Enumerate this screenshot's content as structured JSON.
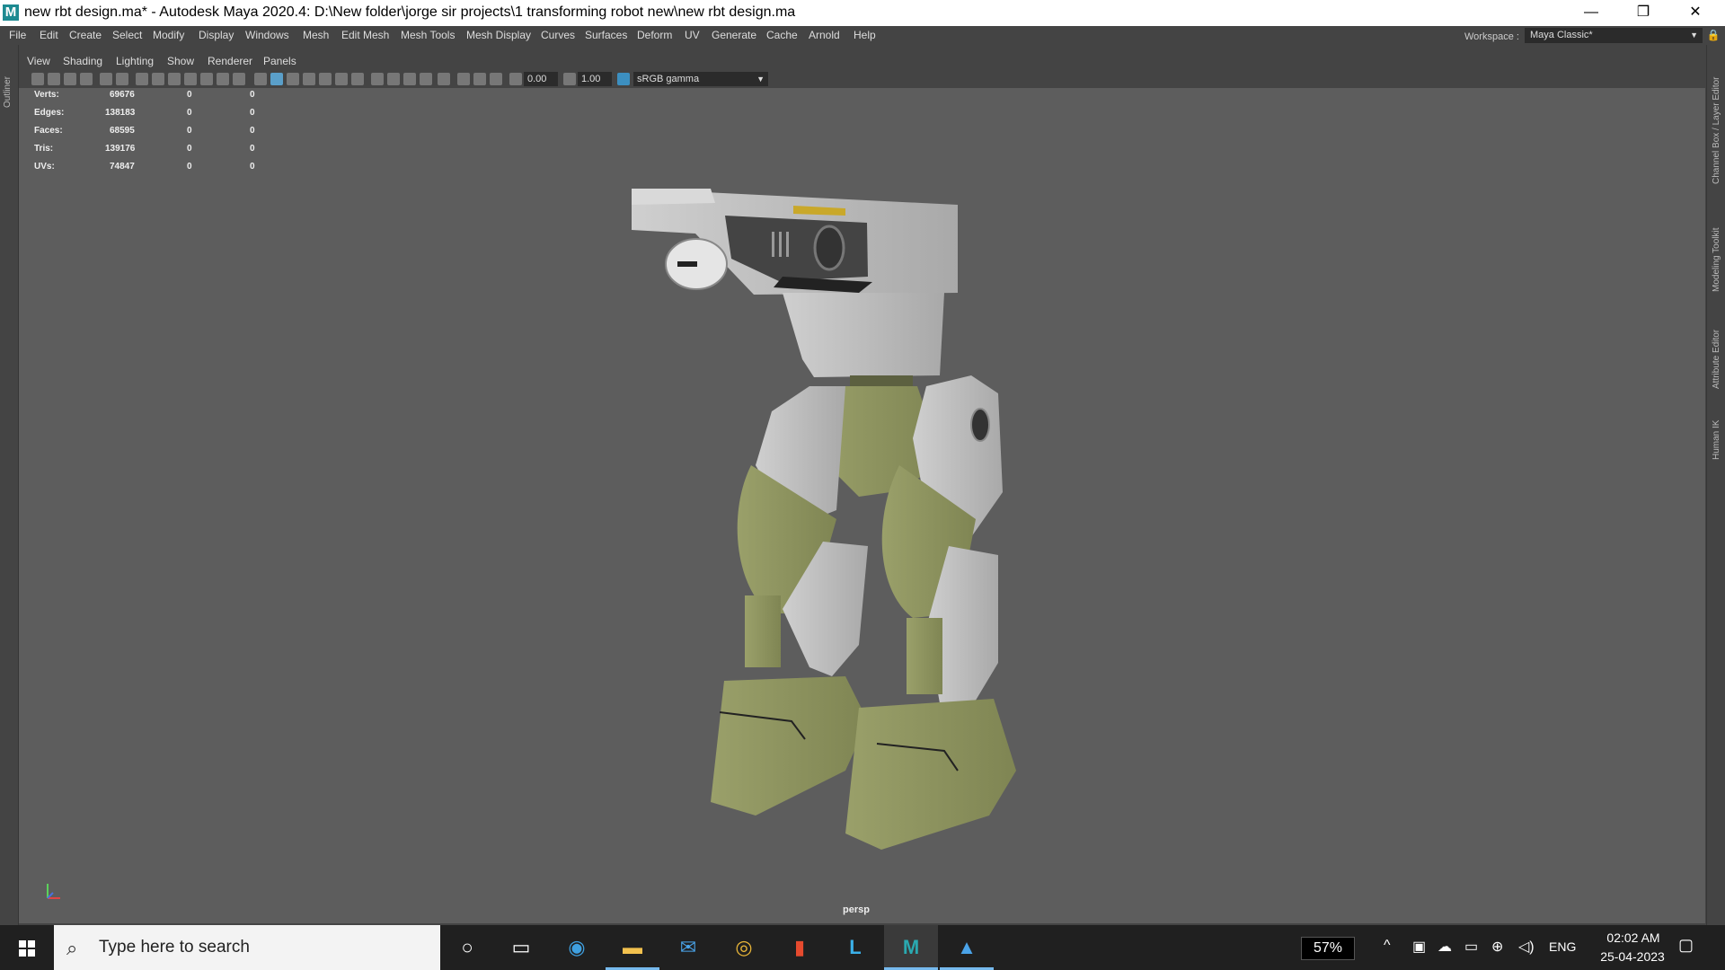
{
  "window": {
    "title": "new rbt design.ma* - Autodesk Maya 2020.4: D:\\New folder\\jorge sir projects\\1 transforming robot new\\new rbt design.ma",
    "app_logo": "M",
    "minimize": "—",
    "restore": "❐",
    "close": "✕"
  },
  "menubar": {
    "items": [
      "File",
      "Edit",
      "Create",
      "Select",
      "Modify",
      "Display",
      "Windows",
      "Mesh",
      "Edit Mesh",
      "Mesh Tools",
      "Mesh Display",
      "Curves",
      "Surfaces",
      "Deform",
      "UV",
      "Generate",
      "Cache",
      "Arnold",
      "Help"
    ],
    "workspace_label": "Workspace :",
    "workspace_value": "Maya Classic*"
  },
  "side_tabs": {
    "left": "Outliner",
    "right": [
      "Channel Box / Layer Editor",
      "Modeling Toolkit",
      "Attribute Editor",
      "Human IK"
    ]
  },
  "panel_menu": [
    "View",
    "Shading",
    "Lighting",
    "Show",
    "Renderer",
    "Panels"
  ],
  "toolbar": {
    "exposure": "0.00",
    "gamma": "1.00",
    "color_space": "sRGB gamma"
  },
  "hud": {
    "rows": [
      {
        "label": "Verts:",
        "v1": "69676",
        "v2": "0",
        "v3": "0"
      },
      {
        "label": "Edges:",
        "v1": "138183",
        "v2": "0",
        "v3": "0"
      },
      {
        "label": "Faces:",
        "v1": "68595",
        "v2": "0",
        "v3": "0"
      },
      {
        "label": "Tris:",
        "v1": "139176",
        "v2": "0",
        "v3": "0"
      },
      {
        "label": "UVs:",
        "v1": "74847",
        "v2": "0",
        "v3": "0"
      }
    ]
  },
  "viewport": {
    "camera": "persp"
  },
  "taskbar": {
    "search_placeholder": "Type here to search",
    "battery": "57%",
    "language": "ENG",
    "time": "02:02 AM",
    "date": "25-04-2023"
  }
}
